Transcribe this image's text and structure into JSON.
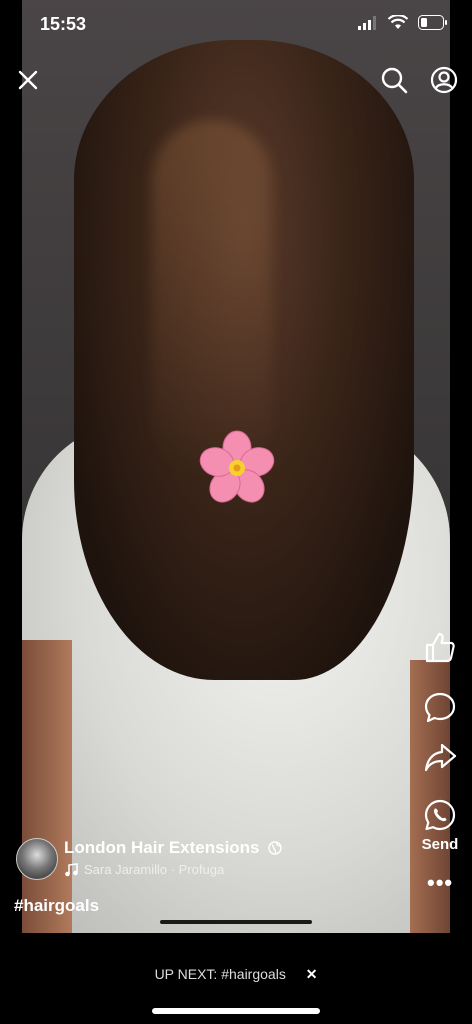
{
  "status_bar": {
    "time": "15:53"
  },
  "post": {
    "page_name": "London Hair Extensions",
    "audio": "Sara Jaramillo · Profuga",
    "hashtag": "#hairgoals"
  },
  "actions": {
    "send_label": "Send"
  },
  "up_next": {
    "label": "UP NEXT: #hairgoals",
    "close": "✕"
  },
  "icons": {
    "close": "close-icon",
    "search": "search-icon",
    "profile": "profile-icon",
    "like": "thumbs-up-icon",
    "comment": "comment-bubble-icon",
    "share": "share-arrow-icon",
    "send": "whatsapp-icon",
    "more": "more-dots-icon",
    "globe": "globe-icon",
    "music": "music-note-icon"
  },
  "colors": {
    "background": "#000000",
    "text": "#ffffff",
    "flower": "#f48fb1"
  }
}
